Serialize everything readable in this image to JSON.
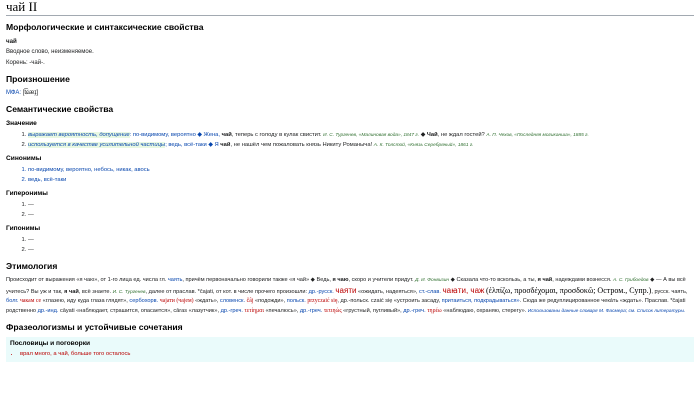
{
  "title": "чай II",
  "morph": {
    "heading": "Морфологические и синтаксические свойства",
    "word": "чай",
    "desc": "Вводное слово, неизменяемое.",
    "root": "Корень: -чай-."
  },
  "pron": {
    "heading": "Произношение",
    "ipa_label": "МФА:",
    "ipa": "[t͡ɕæɪ̯]"
  },
  "semantic": {
    "heading": "Семантические свойства",
    "meaning_heading": "Значение",
    "meanings": [
      {
        "def": "выражает вероятность, допущение",
        "syn": ": по-видимому, вероятно ◆ Жена, ",
        "ex_word": "чай",
        "ex_rest": ", теперь с голоду в кулак свистит.",
        "src": "И. С. Тургенев, «Малиновая вода», 1847 г.",
        "ex2_pre": "◆ ",
        "ex2_word": "Чай",
        "ex2_rest": ", не ждал гостей?",
        "src2": "А. П. Чехов, «Последняя могиканша», 1885 г."
      },
      {
        "def": "используется в качестве усилительной частицы",
        "syn": "; ведь, всё-таки ◆ Я ",
        "ex_word": "чай",
        "ex_rest": ", не нашёл чем пожаловать князь Никиту Романыча!",
        "src": "А. К. Толстой, «Князь Серебряный», 1861 г."
      }
    ],
    "synonyms_heading": "Синонимы",
    "synonyms": [
      "по-видимому, вероятно, небось, никак, авось",
      "ведь, всё-таки"
    ],
    "hyperonyms_heading": "Гиперонимы",
    "hyperonyms": [
      "—",
      "—"
    ],
    "hyponyms_heading": "Гипонимы",
    "hyponyms": [
      "—",
      "—"
    ]
  },
  "etym": {
    "heading": "Этимология",
    "l1a": "Происходит от выражения «я чаю», от 1-го лица ед. числа гл. ",
    "l1b": "чаять",
    "l1c": ", причём первоначально говорили также «я чай» ◆ Ведь, ",
    "l1d": "я чаю",
    "l1e": ", скоро и учители придут.",
    "l1src": "Д. И. Фонвизин",
    "l1f": "◆ Сказала что-то вскользь, а ты, ",
    "l1g": "я чай",
    "l1h": ", надеждами",
    "l2a": "вознесся.",
    "l2src": "А. С. Грибоедов",
    "l2b": "◆ — А вы всё учитесь? Вы уж и так, ",
    "l2c": "я чай",
    "l2d": ", всё знаете.",
    "l2src2": "И. С. Тургенев",
    "l2e": ", далее от праслав. *čajati, от кот. в числе прочего произошли: ",
    "l2f": "др.-русск.",
    "l2g": "чаяти",
    "l2h": "«ожидать, надеяться»,",
    "l2i": "ст.-слав.",
    "l2j": "чаꙗти, чаж",
    "l3a": "(ἐλπίζω, προσδέχομαι, προσδοκῶ; Остром., Супр.)",
    "l3b": ", русск. чаять, ",
    "l3c": "болг.",
    "l3d": "чакам се",
    "l3e": " «глазею, иду куда глаза глядят», ",
    "l3f": "сербохорв.",
    "l3g": "чајати (чајем)",
    "l3h": " «ждать», ",
    "l3i": "словенск.",
    "l3j": "čȃj",
    "l3k": " «подожди», ",
    "l3l": "польск.",
    "l3m": "przyczaić się",
    "l3n": ", др.-польск.",
    "l4a": "czaić się «устроить засаду, ",
    "l4b": "притаиться, подкрадываться»",
    "l4c": ". Сюда же редуплицированное чекáть «ждать». Праслав. *čajati родственно ",
    "l4d": "др.-инд.",
    "l4e": " cāyati «наблюдает, страшится, опасается», cāras «лазутчик», ",
    "l4f": "др.-греч.",
    "l4g": "τετίημαι",
    "l5a": "«печалюсь», ",
    "l5b": "др.-греч.",
    "l5c": "τετιηώς",
    "l5d": " «грустный, пугливый», ",
    "l5e": "др.-греч.",
    "l5f": "τηρέω",
    "l5g": " «наблюдаю, охраняю, стерегу».",
    "l5src": "Использованы данные словаря М. Фасмера; см. Список литературы."
  },
  "phraseo": {
    "heading": "Фразеологизмы и устойчивые сочетания",
    "sub": "Пословицы и поговорки",
    "items": [
      "врал много, а чай, больше того осталось"
    ]
  }
}
